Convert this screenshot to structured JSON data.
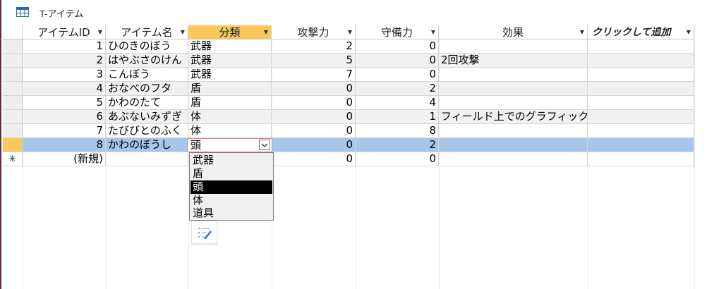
{
  "window": {
    "tab_title": "T-アイテム",
    "tab_icon": "table-icon"
  },
  "grid": {
    "columns": [
      {
        "label": "アイテムID",
        "has_arrow": true
      },
      {
        "label": "アイテム名",
        "has_arrow": true
      },
      {
        "label": "分類",
        "has_arrow": true,
        "selected": true
      },
      {
        "label": "攻撃力",
        "has_arrow": true
      },
      {
        "label": "守備力",
        "has_arrow": true
      },
      {
        "label": "効果",
        "has_arrow": true
      },
      {
        "label": "クリックして追加",
        "has_arrow": true
      }
    ],
    "rows": [
      {
        "id": "1",
        "name": "ひのきのぼう",
        "category": "武器",
        "attack": "2",
        "defense": "0",
        "effect": ""
      },
      {
        "id": "2",
        "name": "はやぶさのけん",
        "category": "武器",
        "attack": "5",
        "defense": "0",
        "effect": "2回攻撃"
      },
      {
        "id": "3",
        "name": "こんぼう",
        "category": "武器",
        "attack": "7",
        "defense": "0",
        "effect": ""
      },
      {
        "id": "4",
        "name": "おなべのフタ",
        "category": "盾",
        "attack": "0",
        "defense": "2",
        "effect": ""
      },
      {
        "id": "5",
        "name": "かわのたて",
        "category": "盾",
        "attack": "0",
        "defense": "4",
        "effect": ""
      },
      {
        "id": "6",
        "name": "あぶないみずぎ",
        "category": "体",
        "attack": "0",
        "defense": "1",
        "effect": "フィールド上でのグラフィック"
      },
      {
        "id": "7",
        "name": "たびびとのふく",
        "category": "体",
        "attack": "0",
        "defense": "8",
        "effect": ""
      },
      {
        "id": "8",
        "name": "かわのぼうし",
        "category": "頭",
        "attack": "0",
        "defense": "2",
        "effect": ""
      }
    ],
    "new_row": {
      "marker": "✳",
      "id_label": "(新規)",
      "attack": "0",
      "defense": "0"
    },
    "current_row_index": 7
  },
  "dropdown": {
    "value": "頭",
    "button_icon": "chevron-down-icon",
    "options": [
      "武器",
      "盾",
      "頭",
      "体",
      "道具"
    ],
    "selected_index": 2
  },
  "smart_tag": {
    "icon": "smart-tag-icon"
  },
  "colors": {
    "selected_header": "#f8c95a",
    "current_row": "#a4c7eb",
    "alt_row": "#f1f1f1",
    "left_border": "#6e2a35"
  }
}
